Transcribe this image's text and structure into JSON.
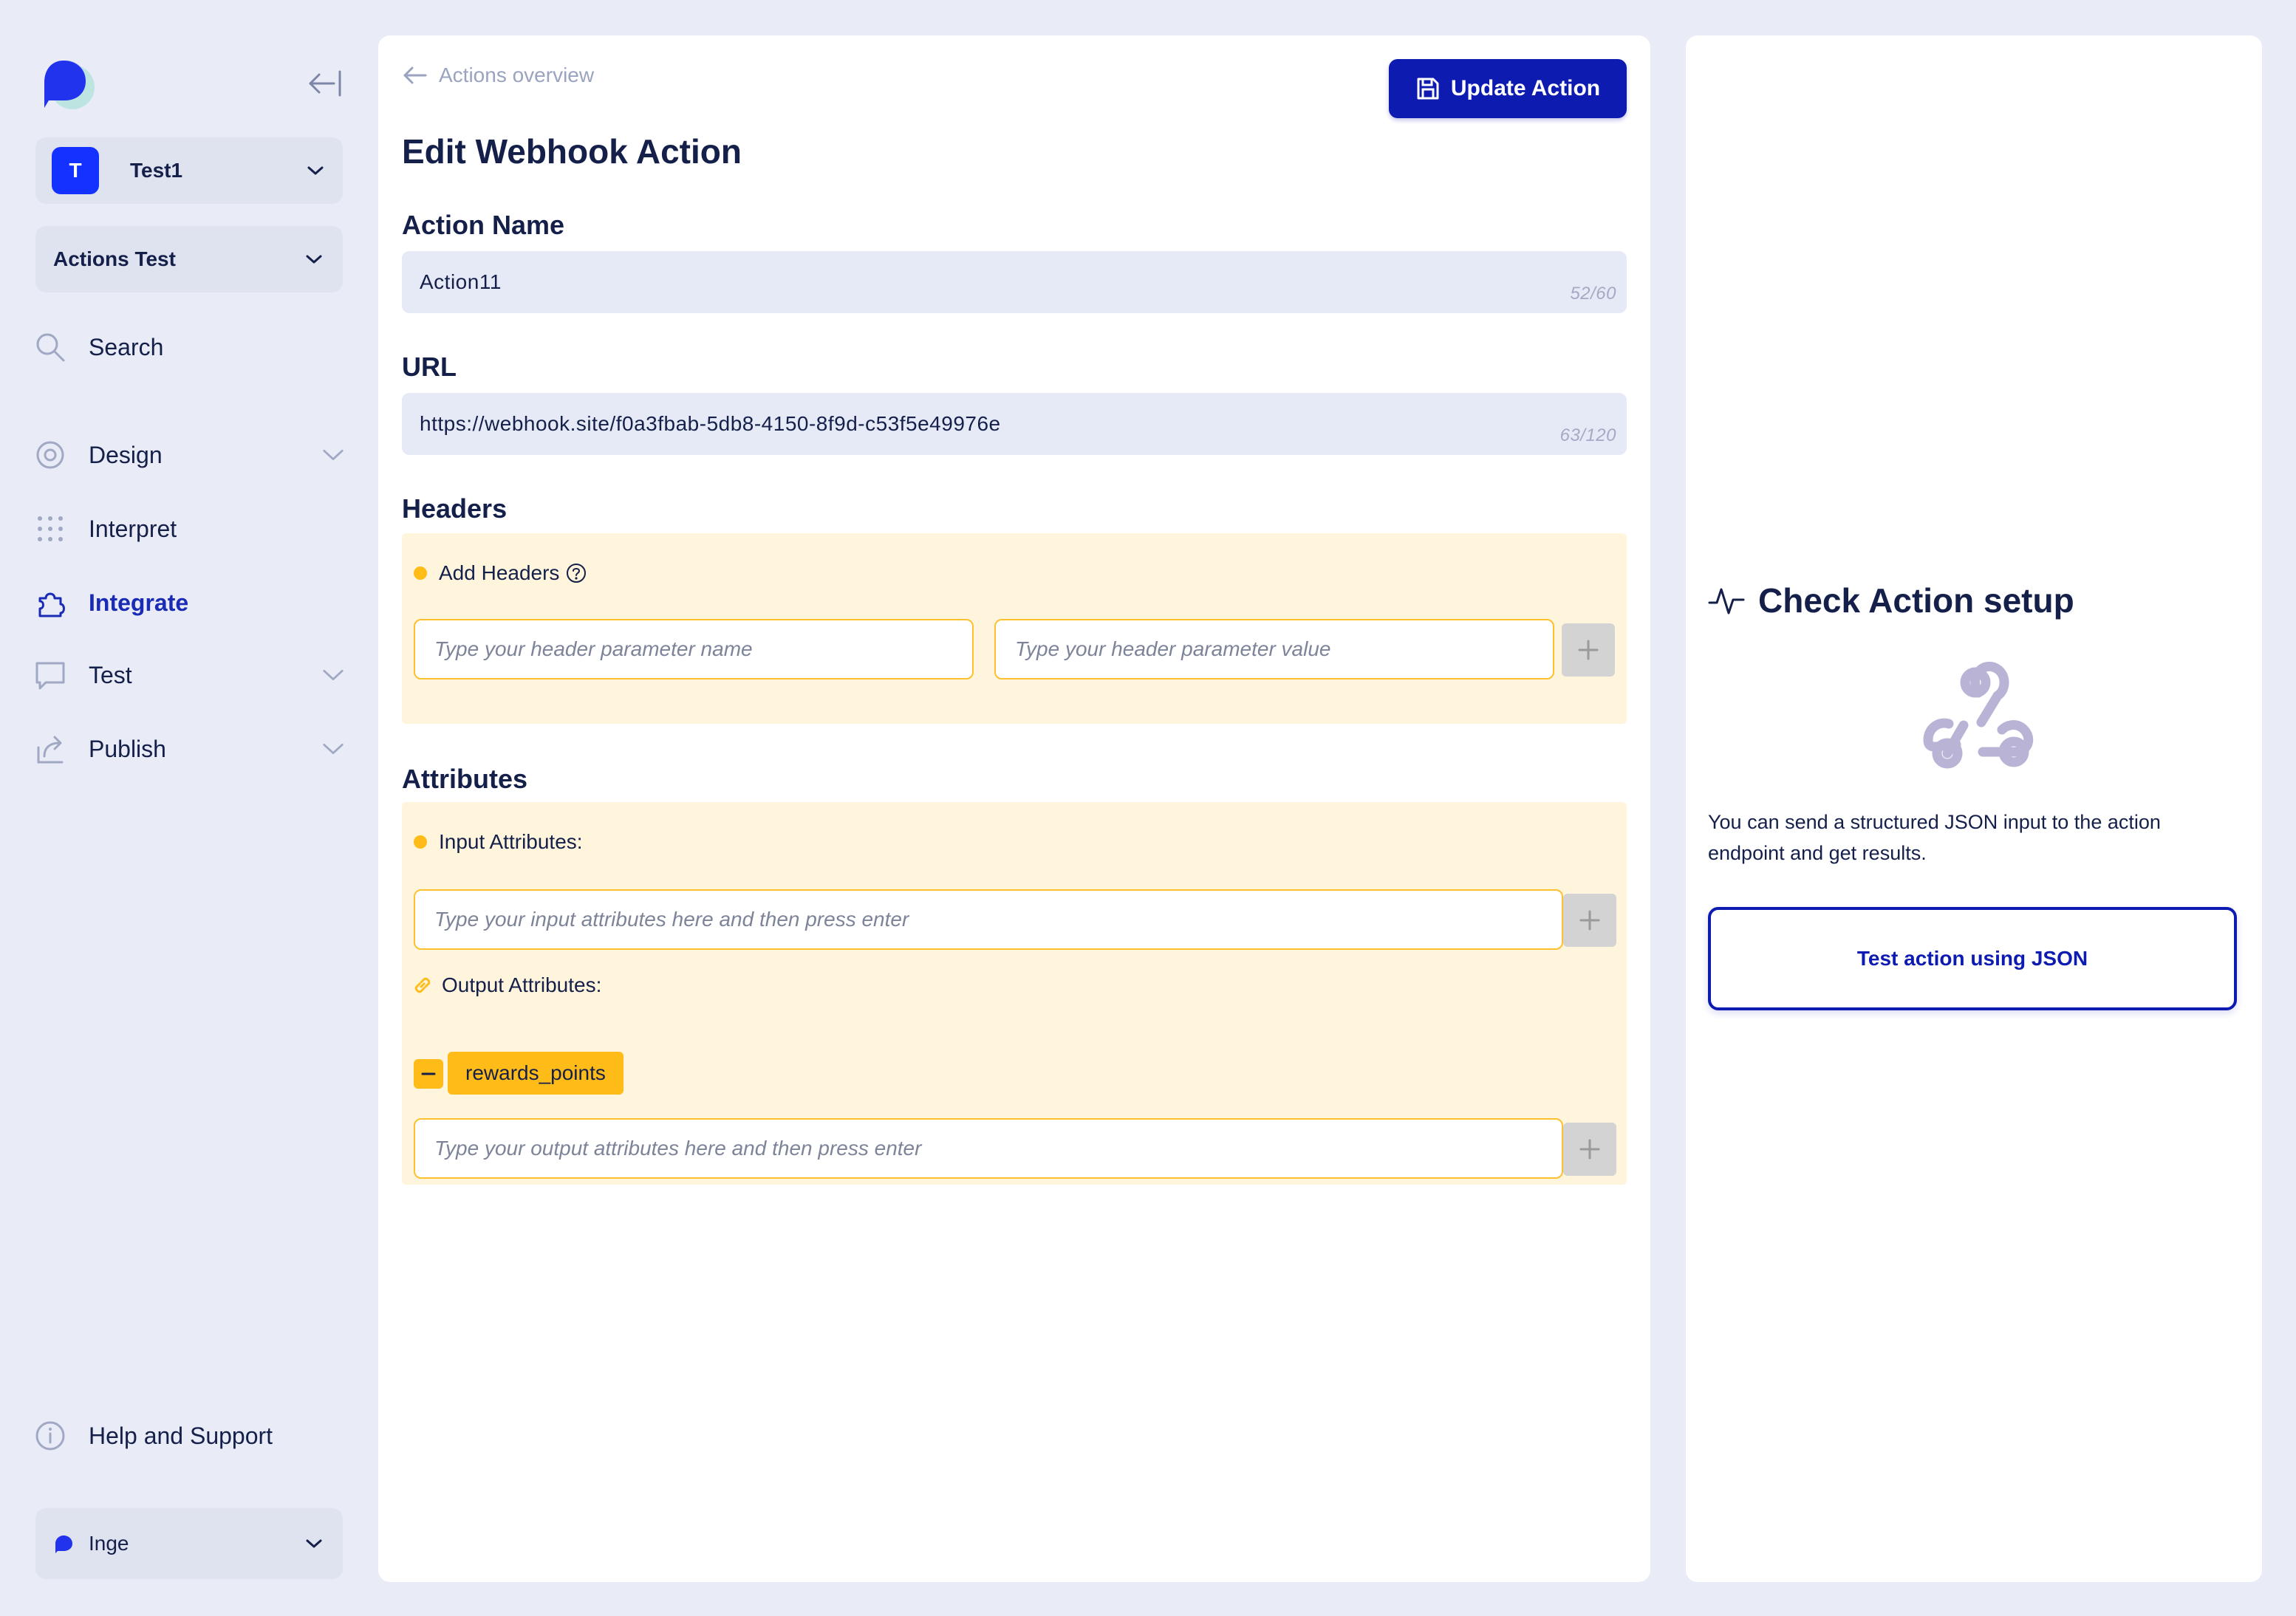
{
  "sidebar": {
    "workspace": {
      "initial": "T",
      "name": "Test1"
    },
    "project": {
      "name": "Actions Test"
    },
    "nav": {
      "search": "Search",
      "design": "Design",
      "interpret": "Interpret",
      "integrate": "Integrate",
      "test": "Test",
      "publish": "Publish",
      "help": "Help and Support"
    },
    "user": {
      "name": "Inge"
    },
    "active_item": "Integrate"
  },
  "main": {
    "breadcrumb": "Actions overview",
    "update_button": "Update Action",
    "title": "Edit Webhook Action",
    "action_name": {
      "label": "Action Name",
      "value": "Action11",
      "counter": "52/60"
    },
    "url": {
      "label": "URL",
      "value": "https://webhook.site/f0a3fbab-5db8-4150-8f9d-c53f5e49976e",
      "counter": "63/120"
    },
    "headers": {
      "label": "Headers",
      "add_label": "Add Headers",
      "name_placeholder": "Type your header parameter name",
      "value_placeholder": "Type your header parameter value"
    },
    "attributes": {
      "label": "Attributes",
      "input_label": "Input Attributes:",
      "input_placeholder": "Type your input attributes here and then press enter",
      "output_label": "Output Attributes:",
      "output_chips": [
        "rewards_points"
      ],
      "output_placeholder": "Type your output attributes here and then press enter"
    }
  },
  "right": {
    "title": "Check Action setup",
    "description": "You can send a structured JSON input to the action endpoint and get results.",
    "test_button": "Test action using JSON"
  },
  "colors": {
    "primary": "#0e1bb0",
    "accent_yellow": "#ffbb18",
    "background": "#e9ecf6",
    "text": "#14204a"
  },
  "icons": [
    "app-logo",
    "collapse-sidebar-icon",
    "chevron-down-icon",
    "search-icon",
    "design-icon",
    "interpret-icon",
    "integrate-icon",
    "test-icon",
    "publish-icon",
    "help-icon",
    "arrow-left-icon",
    "save-icon",
    "help-circle-icon",
    "plus-icon",
    "link-icon",
    "minus-icon",
    "activity-icon",
    "webhook-icon"
  ]
}
